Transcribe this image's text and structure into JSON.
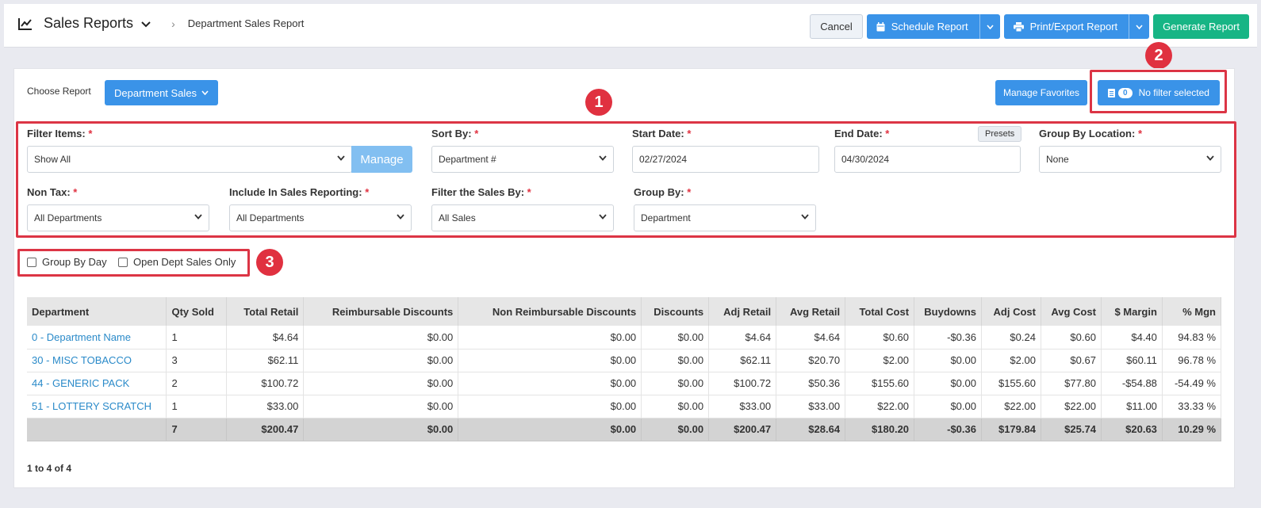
{
  "header": {
    "title": "Sales Reports",
    "breadcrumb": "Department Sales Report",
    "cancel_label": "Cancel",
    "schedule_label": "Schedule Report",
    "print_label": "Print/Export Report",
    "generate_label": "Generate Report"
  },
  "toolbar": {
    "choose_label": "Choose Report",
    "report_selected": "Department Sales",
    "manage_favorites": "Manage Favorites",
    "filter_count": "0",
    "filter_label": "No filter selected"
  },
  "markers": [
    "1",
    "2",
    "3"
  ],
  "filters": {
    "filter_items": {
      "label": "Filter Items:",
      "value": "Show All",
      "manage": "Manage"
    },
    "sort_by": {
      "label": "Sort By:",
      "value": "Department #"
    },
    "start_date": {
      "label": "Start Date:",
      "value": "02/27/2024"
    },
    "end_date": {
      "label": "End Date:",
      "value": "04/30/2024",
      "presets": "Presets"
    },
    "group_by_location": {
      "label": "Group By Location:",
      "value": "None"
    },
    "non_tax": {
      "label": "Non Tax:",
      "value": "All Departments"
    },
    "include_in_sales": {
      "label": "Include In Sales Reporting:",
      "value": "All Departments"
    },
    "filter_sales_by": {
      "label": "Filter the Sales By:",
      "value": "All Sales"
    },
    "group_by": {
      "label": "Group By:",
      "value": "Department"
    },
    "required_mark": "*"
  },
  "options": {
    "group_by_day": "Group By Day",
    "open_dept_only": "Open Dept Sales Only"
  },
  "table": {
    "columns": [
      "Department",
      "Qty Sold",
      "Total Retail",
      "Reimbursable Discounts",
      "Non Reimbursable Discounts",
      "Discounts",
      "Adj Retail",
      "Avg Retail",
      "Total Cost",
      "Buydowns",
      "Adj Cost",
      "Avg Cost",
      "$ Margin",
      "% Mgn"
    ],
    "rows": [
      [
        "0 - Department Name",
        "1",
        "$4.64",
        "$0.00",
        "$0.00",
        "$0.00",
        "$4.64",
        "$4.64",
        "$0.60",
        "-$0.36",
        "$0.24",
        "$0.60",
        "$4.40",
        "94.83 %"
      ],
      [
        "30 - MISC TOBACCO",
        "3",
        "$62.11",
        "$0.00",
        "$0.00",
        "$0.00",
        "$62.11",
        "$20.70",
        "$2.00",
        "$0.00",
        "$2.00",
        "$0.67",
        "$60.11",
        "96.78 %"
      ],
      [
        "44 - GENERIC PACK",
        "2",
        "$100.72",
        "$0.00",
        "$0.00",
        "$0.00",
        "$100.72",
        "$50.36",
        "$155.60",
        "$0.00",
        "$155.60",
        "$77.80",
        "-$54.88",
        "-54.49 %"
      ],
      [
        "51 - LOTTERY SCRATCH",
        "1",
        "$33.00",
        "$0.00",
        "$0.00",
        "$0.00",
        "$33.00",
        "$33.00",
        "$22.00",
        "$0.00",
        "$22.00",
        "$22.00",
        "$11.00",
        "33.33 %"
      ]
    ],
    "totals": [
      "",
      "7",
      "$200.47",
      "$0.00",
      "$0.00",
      "$0.00",
      "$200.47",
      "$28.64",
      "$180.20",
      "-$0.36",
      "$179.84",
      "$25.74",
      "$20.63",
      "10.29 %"
    ],
    "pager": "1 to 4 of 4"
  },
  "colors": {
    "primary": "#3a93e8",
    "success": "#17b585",
    "danger": "#dc3545",
    "link": "#2a8ac9"
  }
}
